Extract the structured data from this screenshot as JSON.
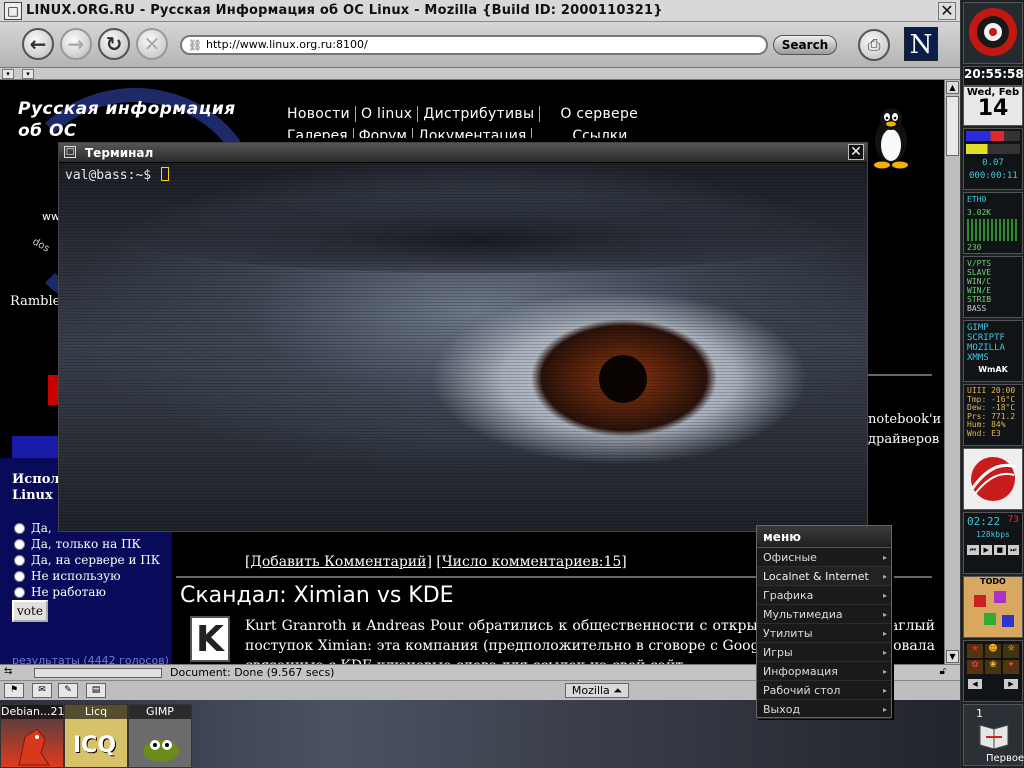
{
  "window": {
    "title": "LINUX.ORG.RU - Русская Информация об ОС Linux - Mozilla {Build ID: 2000110321}",
    "menu_glyph": "□",
    "close_glyph": "✕"
  },
  "navbar": {
    "back_glyph": "←",
    "forward_glyph": "→",
    "reload_glyph": "↻",
    "stop_glyph": "✕",
    "url": "http://www.linux.org.ru:8100/",
    "search_label": "Search",
    "print_glyph": "⎙",
    "logo": "N"
  },
  "site": {
    "title_line1": "Русская информация",
    "title_line2": "об ОС",
    "partial_ww": "ww",
    "partial_dos": "dos",
    "nav_row1": [
      "Новости",
      "О linux",
      "Дистрибутивы",
      "О сервере"
    ],
    "nav_row2": [
      "Галерея",
      "Форум",
      "Документация",
      "Ссылки"
    ],
    "rambler": "Rambler",
    "right_text_line1": "notebook'и",
    "right_text_line2": "драйверов"
  },
  "poll": {
    "question_line1": "Испол",
    "question_line2": "Linux :",
    "options": [
      "Да,",
      "Да, только на ПК",
      "Да, на сервере и ПК",
      "Не использую",
      "Не работаю"
    ],
    "vote_label": "vote",
    "results_link": "результаты (4442 голосов)"
  },
  "news": {
    "add_comment": "[Добавить Комментарий]",
    "comment_count": "[Число комментариев:15]",
    "headline": "Скандал: Ximian vs KDE",
    "k_logo": "K",
    "article": "Kurt Granroth и Andreas Pour обратились к общественности с открытым письмом ... наглый поступок Ximian: эта компания (предположительно в сговоре с Google) ... зарегистрировала связанные с KDE ключевые слова для ссылок на свой сайт."
  },
  "status": {
    "text": "Document: Done (9.567 secs)",
    "mozilla_btn": "Mozilla ⏶"
  },
  "terminal": {
    "title": "Терминал",
    "prompt": "val@bass:~$ "
  },
  "menu": {
    "title": "меню",
    "items": [
      "Офисные приложения",
      "Localnet & Internet",
      "Графика",
      "Мультимедиа",
      "Утилиты",
      "Игры",
      "Информация",
      "Рабочий стол",
      "Выход"
    ],
    "submenu_glyph": "▸"
  },
  "dock": {
    "time": "20:55:58",
    "weekday_month": "Wed, Feb",
    "day": "14",
    "load": "0.07",
    "uptime": "000:00:11",
    "net_label": "ETH0",
    "net_val": "3.02K",
    "net_val2": "230",
    "mon_lines": [
      "V/PTS",
      "SLAVE",
      "WIN/C",
      "WIN/E",
      "STRIB"
    ],
    "mon_bass": "BASS",
    "launch_lines": [
      "GIMP",
      "SCRIPTF",
      "MOZILLA",
      "XMMS"
    ],
    "wmak": "WmAK",
    "weather_lines": [
      "UIII  20:00",
      "Tmp: -16°C",
      "Dew: -18°C",
      "Prs: 771.2",
      "Hum: 84%",
      "Wnd: E3"
    ],
    "player_time": "02:22",
    "player_track": "73",
    "player_rate": "128kbps",
    "todo": "TODO",
    "pager_num": "1",
    "pager_label": "Первое"
  },
  "taskbar": {
    "apps": [
      "Debian...21}",
      "Licq",
      "GIMP"
    ],
    "icq_text": "ICQ"
  },
  "colors": {
    "menu_bg": "#1a1a1a",
    "terminal_iris": "#8a3510",
    "site_bg": "#000000",
    "link": "#6b7bdd"
  }
}
